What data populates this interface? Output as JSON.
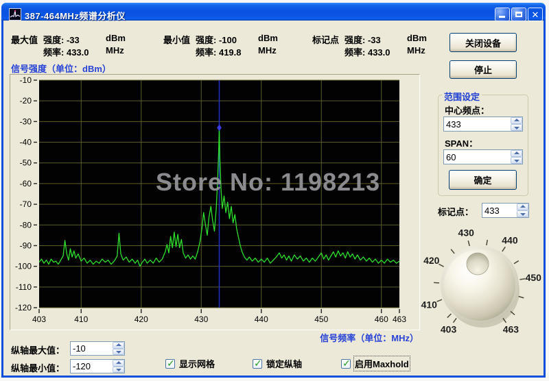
{
  "window": {
    "title": "387-464MHz频谱分析仪",
    "buttons": {
      "minimize": "minimize",
      "maximize": "maximize",
      "close": "close"
    }
  },
  "readouts": {
    "max": {
      "name": "最大值",
      "rows": [
        {
          "label": "强度:",
          "value": "-33",
          "unit": "dBm"
        },
        {
          "label": "频率:",
          "value": "433.0",
          "unit": "MHz"
        }
      ]
    },
    "min": {
      "name": "最小值",
      "rows": [
        {
          "label": "强度:",
          "value": "-100",
          "unit": "dBm"
        },
        {
          "label": "频率:",
          "value": "419.8",
          "unit": "MHz"
        }
      ]
    },
    "marker": {
      "name": "标记点",
      "rows": [
        {
          "label": "强度:",
          "value": "-33",
          "unit": "dBm"
        },
        {
          "label": "频率:",
          "value": "433.0",
          "unit": "MHz"
        }
      ]
    }
  },
  "watermark": {
    "text": "Store No: 1198213"
  },
  "chart_data": {
    "type": "line",
    "y_label": "信号强度（单位：dBm）",
    "x_label": "信号频率（单位：MHz）",
    "x_range": [
      403,
      463
    ],
    "y_range": [
      -120,
      -10
    ],
    "x_ticks": [
      403,
      410,
      420,
      430,
      440,
      450,
      460,
      463
    ],
    "y_ticks": [
      -10,
      -20,
      -30,
      -40,
      -50,
      -60,
      -70,
      -80,
      -90,
      -100,
      -110,
      -120
    ],
    "grid": true,
    "grid_color": "#5d5d26",
    "trace_color": "#2ee02e",
    "bg_color": "#020202",
    "marker": {
      "freq": 433.0,
      "level": -33,
      "line_color": "#2334cc",
      "dot_color": "#3c3ce8"
    },
    "series": [
      {
        "name": "spectrum",
        "points": [
          [
            403,
            -98
          ],
          [
            403.4,
            -96.5
          ],
          [
            403.8,
            -98.5
          ],
          [
            404.2,
            -97
          ],
          [
            404.6,
            -99
          ],
          [
            405,
            -96.5
          ],
          [
            405.4,
            -98
          ],
          [
            405.8,
            -97.5
          ],
          [
            406.2,
            -99
          ],
          [
            406.6,
            -97
          ],
          [
            407,
            -95
          ],
          [
            407.3,
            -87.5
          ],
          [
            407.6,
            -94
          ],
          [
            407.9,
            -97
          ],
          [
            408.2,
            -91.5
          ],
          [
            408.5,
            -95.5
          ],
          [
            408.8,
            -92.5
          ],
          [
            409.1,
            -96
          ],
          [
            409.5,
            -94
          ],
          [
            410,
            -97.5
          ],
          [
            410.5,
            -96
          ],
          [
            411,
            -98.5
          ],
          [
            411.5,
            -97
          ],
          [
            412,
            -99
          ],
          [
            412.5,
            -97.5
          ],
          [
            413,
            -98.5
          ],
          [
            413.5,
            -96.5
          ],
          [
            414,
            -98
          ],
          [
            414.5,
            -97
          ],
          [
            415,
            -99
          ],
          [
            415.5,
            -97.5
          ],
          [
            416,
            -95
          ],
          [
            416.3,
            -84
          ],
          [
            416.6,
            -94
          ],
          [
            417,
            -97
          ],
          [
            417.5,
            -95.5
          ],
          [
            418,
            -98
          ],
          [
            418.5,
            -96.5
          ],
          [
            419,
            -98.5
          ],
          [
            419.4,
            -97
          ],
          [
            419.8,
            -100
          ],
          [
            420.2,
            -98
          ],
          [
            420.6,
            -96.5
          ],
          [
            421,
            -98.5
          ],
          [
            421.5,
            -97
          ],
          [
            422,
            -98.5
          ],
          [
            422.5,
            -96
          ],
          [
            423,
            -98
          ],
          [
            423.5,
            -96.5
          ],
          [
            424,
            -93
          ],
          [
            424.3,
            -89.5
          ],
          [
            424.6,
            -93.5
          ],
          [
            424.9,
            -85.5
          ],
          [
            425.2,
            -91
          ],
          [
            425.5,
            -83.5
          ],
          [
            425.8,
            -90.5
          ],
          [
            426.1,
            -84.5
          ],
          [
            426.4,
            -91
          ],
          [
            426.7,
            -87
          ],
          [
            427,
            -93.5
          ],
          [
            427.4,
            -96
          ],
          [
            427.8,
            -94.5
          ],
          [
            428.2,
            -96.5
          ],
          [
            428.6,
            -95
          ],
          [
            429,
            -96.5
          ],
          [
            429.4,
            -93
          ],
          [
            429.8,
            -88
          ],
          [
            430.1,
            -82
          ],
          [
            430.4,
            -74
          ],
          [
            430.7,
            -80
          ],
          [
            431,
            -85
          ],
          [
            431.3,
            -76
          ],
          [
            431.6,
            -71
          ],
          [
            431.9,
            -78
          ],
          [
            432.2,
            -83
          ],
          [
            432.5,
            -72
          ],
          [
            432.7,
            -60
          ],
          [
            432.9,
            -45
          ],
          [
            433,
            -33
          ],
          [
            433.1,
            -48
          ],
          [
            433.3,
            -63
          ],
          [
            433.5,
            -72
          ],
          [
            433.8,
            -66
          ],
          [
            434.1,
            -74
          ],
          [
            434.4,
            -69
          ],
          [
            434.7,
            -77
          ],
          [
            435,
            -71
          ],
          [
            435.3,
            -79
          ],
          [
            435.6,
            -75
          ],
          [
            435.9,
            -82
          ],
          [
            436.2,
            -86
          ],
          [
            436.5,
            -90
          ],
          [
            436.8,
            -93
          ],
          [
            437.2,
            -95.5
          ],
          [
            437.6,
            -97
          ],
          [
            438,
            -95.5
          ],
          [
            438.5,
            -97.5
          ],
          [
            439,
            -96
          ],
          [
            439.5,
            -98
          ],
          [
            440,
            -96.5
          ],
          [
            440.5,
            -98
          ],
          [
            441,
            -96
          ],
          [
            441.5,
            -98.5
          ],
          [
            442,
            -97
          ],
          [
            442.5,
            -95.5
          ],
          [
            443,
            -93.5
          ],
          [
            443.4,
            -96
          ],
          [
            443.8,
            -94.5
          ],
          [
            444.2,
            -97
          ],
          [
            444.6,
            -95
          ],
          [
            445,
            -97.5
          ],
          [
            445.5,
            -94.5
          ],
          [
            446,
            -96.5
          ],
          [
            446.5,
            -95
          ],
          [
            447,
            -97.5
          ],
          [
            447.5,
            -96
          ],
          [
            448,
            -98
          ],
          [
            448.5,
            -96
          ],
          [
            449,
            -97.5
          ],
          [
            449.5,
            -95.5
          ],
          [
            450,
            -93.5
          ],
          [
            450.4,
            -96.5
          ],
          [
            450.8,
            -94.5
          ],
          [
            451.2,
            -97
          ],
          [
            451.6,
            -95
          ],
          [
            452,
            -93
          ],
          [
            452.4,
            -95.5
          ],
          [
            452.8,
            -92.5
          ],
          [
            453.2,
            -95
          ],
          [
            453.6,
            -93.5
          ],
          [
            454,
            -96
          ],
          [
            454.4,
            -93
          ],
          [
            454.8,
            -95.5
          ],
          [
            455.2,
            -94
          ],
          [
            455.6,
            -96.5
          ],
          [
            456,
            -94.5
          ],
          [
            456.5,
            -97
          ],
          [
            457,
            -95.5
          ],
          [
            457.5,
            -97.5
          ],
          [
            458,
            -96
          ],
          [
            458.5,
            -98
          ],
          [
            459,
            -96.5
          ],
          [
            459.5,
            -98.5
          ],
          [
            460,
            -97
          ],
          [
            460.5,
            -98.5
          ],
          [
            461,
            -96.5
          ],
          [
            461.5,
            -98
          ],
          [
            462,
            -97
          ],
          [
            462.5,
            -98.5
          ],
          [
            463,
            -97.5
          ]
        ]
      }
    ]
  },
  "right_panel": {
    "close_device_button": "关闭设备",
    "stop_button": "停止",
    "group_title": "范围设定",
    "center_freq_label": "中心频点：",
    "center_freq_value": "433",
    "span_label": "SPAN：",
    "span_value": "60",
    "ok_button": "确定",
    "marker_label": "标记点：",
    "marker_value": "433",
    "knob": {
      "labels": [
        403,
        410,
        420,
        430,
        440,
        450,
        463
      ],
      "ticks": [
        403,
        405,
        410,
        415,
        420,
        425,
        430,
        435,
        440,
        445,
        450,
        455,
        460,
        463
      ],
      "min": 403,
      "max": 463,
      "center": 433,
      "deg_per_unit": 4.83
    }
  },
  "controls_bottom": {
    "ymax_label": "纵轴最大值：",
    "ymax_value": "-10",
    "ymin_label": "纵轴最小值：",
    "ymin_value": "-120",
    "checkboxes": [
      {
        "label": "显示网格",
        "checked": true
      },
      {
        "label": "锁定纵轴",
        "checked": true
      },
      {
        "label": "启用Maxhold",
        "checked": true,
        "focused": true
      }
    ]
  }
}
